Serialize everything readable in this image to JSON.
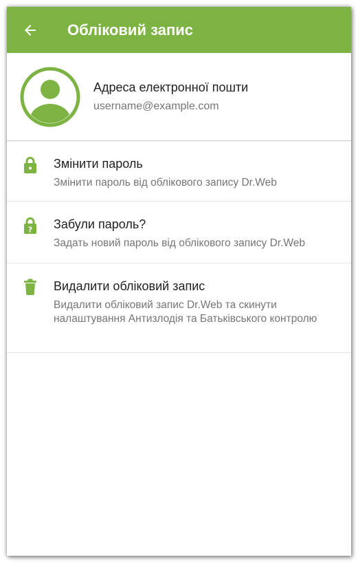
{
  "colors": {
    "accent": "#7cb342",
    "appbar_text": "#ffffff",
    "primary_text": "#212121",
    "secondary_text": "#757575"
  },
  "appbar": {
    "back_icon": "arrow-left-icon",
    "title": "Обліковий запис"
  },
  "account": {
    "avatar_icon": "user-avatar-icon",
    "label": "Адреса електронної пошти",
    "email": "username@example.com"
  },
  "items": [
    {
      "icon": "lock-icon",
      "title": "Змінити пароль",
      "subtitle": "Змінити пароль від облікового запису Dr.Web"
    },
    {
      "icon": "lock-question-icon",
      "title": "Забули пароль?",
      "subtitle": "Задать новий пароль від облікового запису Dr.Web"
    },
    {
      "icon": "trash-icon",
      "title": "Видалити обліковий запис",
      "subtitle": "Видалити обліковий запис Dr.Web та скинути налаштування Антизлодія та Батьківського контролю"
    }
  ]
}
